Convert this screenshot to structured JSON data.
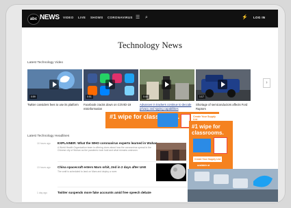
{
  "nav": {
    "brand": "NEWS",
    "logo_text": "abc",
    "items": [
      "VIDEO",
      "LIVE",
      "SHOWS",
      "CORONAVIRUS"
    ],
    "login_label": "LOG IN",
    "icons": [
      "menu-icon",
      "search-icon",
      "notification-icon"
    ]
  },
  "page": {
    "title": "Technology News",
    "videos_heading": "Latest Technology Video",
    "headlines_heading": "Latest Technology Headlines"
  },
  "videos": [
    {
      "caption": "Twitter considers fees to use its platform",
      "duration": "0:59"
    },
    {
      "caption": "Facebook cracks down on COVID-19 misinformation",
      "duration": "0:51"
    },
    {
      "caption": "Advances in trackers continue to decode privacy and spying capabilities",
      "duration": "0:46"
    },
    {
      "caption": "Shortage of semiconductors affects Ford Raptors",
      "duration": "1:17"
    }
  ],
  "ad_banner": {
    "headline": "#1 wipe for classrooms.",
    "cta": "Create Your Supply List",
    "available": "available at"
  },
  "ad_side": {
    "headline": "#1 wipe for classrooms.",
    "cta": "Create Your Supply List",
    "available": "available at"
  },
  "headlines": [
    {
      "time": "10 hours ago",
      "headline": "EXPLAINER: What the WHO coronavirus experts learned in Wuhan",
      "summary": "A World Health Organization team is offering clues about how the coronavirus spread in the Chinese city of Wuhan as the pandemic took hold and what remains unknown."
    },
    {
      "time": "13 hours ago",
      "headline": "China spacecraft enters Mars orbit, 2nd in 2 days after UAE",
      "summary": "The craft is scheduled to land on Mars and deploy a rover."
    },
    {
      "time": "1 day ago",
      "headline": "Twitter suspends more fake accounts amid free speech debate",
      "summary": ""
    }
  ],
  "colors": {
    "nav_bg": "#111111",
    "ad_orange": "#f58220"
  }
}
